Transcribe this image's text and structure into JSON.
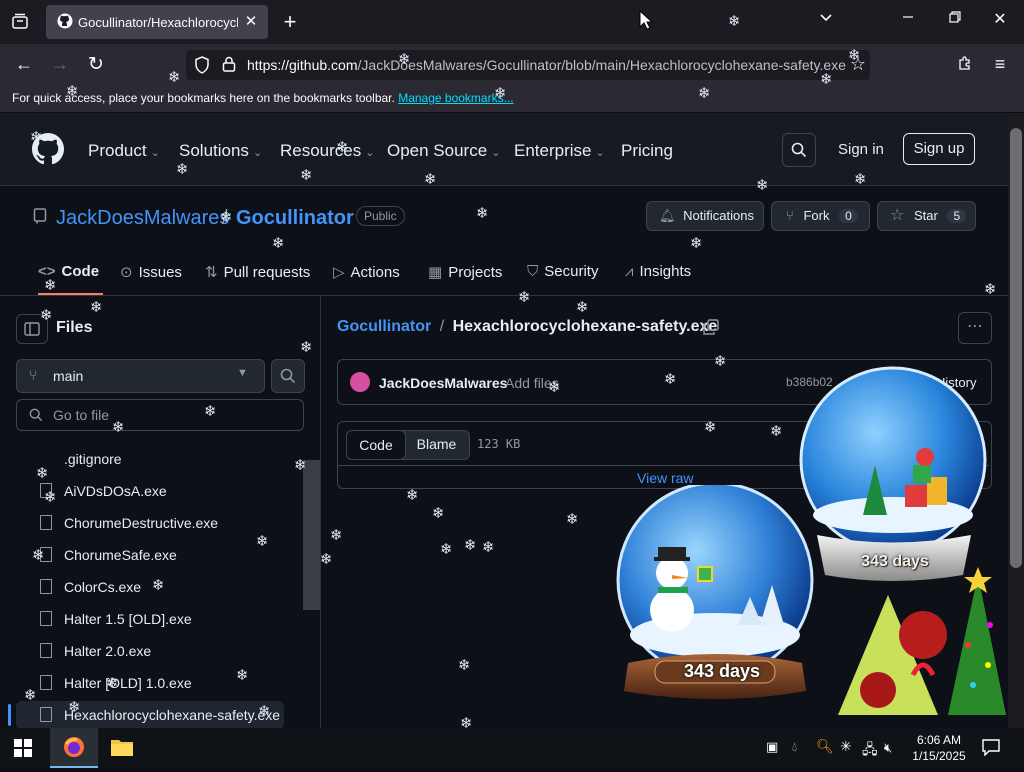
{
  "browser": {
    "tab_title": "Gocullinator/Hexachlorocyclohexane-safety.exe",
    "url_prefix": "https://github.com",
    "url_path": "/JackDoesMalwares/Gocullinator/blob/main/Hexachlorocyclohexane-safety.exe",
    "bookmarks_text": "For quick access, place your bookmarks here on the bookmarks toolbar.",
    "bookmarks_link": "Manage bookmarks..."
  },
  "github": {
    "nav": [
      "Product",
      "Solutions",
      "Resources",
      "Open Source",
      "Enterprise",
      "Pricing"
    ],
    "sign_in": "Sign in",
    "sign_up": "Sign up"
  },
  "repo": {
    "owner": "JackDoesMalwares",
    "name": "Gocullinator",
    "visibility": "Public",
    "notifications": "Notifications",
    "fork_label": "Fork",
    "fork_count": "0",
    "star_label": "Star",
    "star_count": "5",
    "tabs": [
      "Code",
      "Issues",
      "Pull requests",
      "Actions",
      "Projects",
      "Security",
      "Insights"
    ]
  },
  "sidebar": {
    "title": "Files",
    "branch": "main",
    "goto_placeholder": "Go to file",
    "files": [
      ".gitignore",
      "AiVDsDOsA.exe",
      "ChorumeDestructive.exe",
      "ChorumeSafe.exe",
      "ColorCs.exe",
      "Halter 1.5 [OLD].exe",
      "Halter 2.0.exe",
      "Halter [OLD] 1.0.exe",
      "Hexachlorocyclohexane-safety.exe"
    ]
  },
  "main": {
    "crumb_repo": "Gocullinator",
    "crumb_sep": "/",
    "crumb_file": "Hexachlorocyclohexane-safety.exe",
    "commit_author": "JackDoesMalwares",
    "commit_msg": "Add files",
    "commit_hash": "b386b02",
    "history": "History",
    "code_btn": "Code",
    "blame_btn": "Blame",
    "size": "123 KB",
    "view_raw": "View raw"
  },
  "overlay": {
    "days_left": "343 days",
    "days_right": "343 days"
  },
  "taskbar": {
    "time": "6:06 AM",
    "date": "1/15/2025"
  },
  "colors": {
    "accent": "#4493f8",
    "tab_underline": "#f78166",
    "bg": "#0d1117"
  }
}
